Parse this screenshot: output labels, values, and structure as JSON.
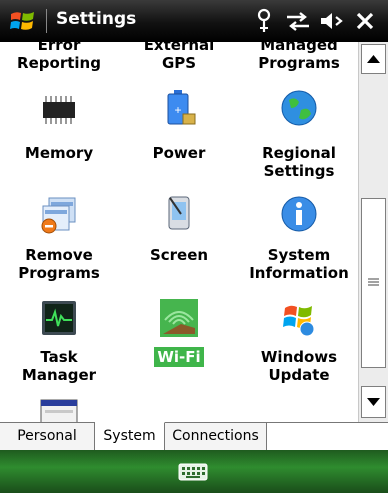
{
  "titlebar": {
    "title": "Settings",
    "icons": [
      "windows-start-icon",
      "antenna-icon",
      "connectivity-icon",
      "volume-icon",
      "close-icon"
    ]
  },
  "settings": {
    "partial_top": [
      "Error\nReporting",
      "External\nGPS",
      "Managed\nPrograms"
    ],
    "items": [
      {
        "label": "Memory",
        "icon": "memory-chip-icon"
      },
      {
        "label": "Power",
        "icon": "battery-icon"
      },
      {
        "label": "Regional\nSettings",
        "icon": "globe-icon"
      },
      {
        "label": "Remove\nPrograms",
        "icon": "remove-programs-icon"
      },
      {
        "label": "Screen",
        "icon": "screen-stylus-icon"
      },
      {
        "label": "System\nInformation",
        "icon": "info-icon"
      },
      {
        "label": "Task\nManager",
        "icon": "task-manager-icon"
      },
      {
        "label": "Wi-Fi",
        "icon": "wifi-icon",
        "selected": true
      },
      {
        "label": "Windows\nUpdate",
        "icon": "windows-update-icon"
      }
    ]
  },
  "tabs": [
    {
      "label": "Personal"
    },
    {
      "label": "System",
      "active": true
    },
    {
      "label": "Connections"
    }
  ],
  "softkeys": {
    "icon": "keyboard-icon"
  },
  "colors": {
    "selection": "#3fb54a",
    "bottombar": "#2f8c2f",
    "titlebar": "#111111"
  }
}
